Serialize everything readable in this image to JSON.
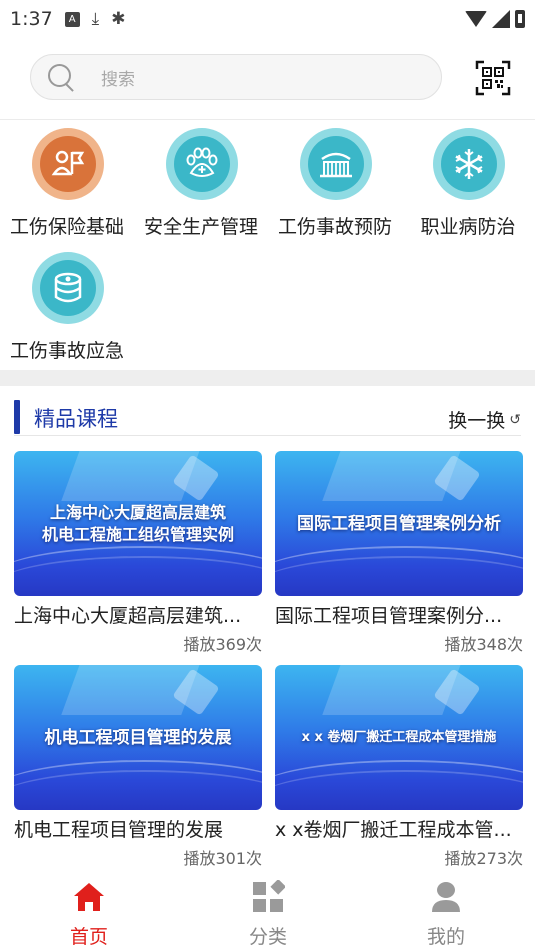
{
  "status_bar": {
    "time": "1:37"
  },
  "search": {
    "placeholder": "搜索"
  },
  "categories": [
    {
      "label": "工伤保险基础",
      "icon": "insurance-person-flag-icon",
      "color": "#d9733a",
      "ring": "#f0b48a"
    },
    {
      "label": "安全生产管理",
      "icon": "safety-paw-icon",
      "color": "#3bb7c8",
      "ring": "#8fdbe3"
    },
    {
      "label": "工伤事故预防",
      "icon": "fence-prevention-icon",
      "color": "#3bb7c8",
      "ring": "#8fdbe3"
    },
    {
      "label": "职业病防治",
      "icon": "snowflake-icon",
      "color": "#3bb7c8",
      "ring": "#8fdbe3"
    },
    {
      "label": "工伤事故应急",
      "icon": "database-gear-icon",
      "color": "#3bb7c8",
      "ring": "#8fdbe3"
    }
  ],
  "section": {
    "title": "精品课程",
    "refresh_label": "换一换"
  },
  "courses": [
    {
      "thumb_line1": "上海中心大厦超高层建筑",
      "thumb_line2": "机电工程施工组织管理实例",
      "title": "上海中心大厦超高层建筑...",
      "plays": "播放369次"
    },
    {
      "thumb_line1": "国际工程项目管理案例分析",
      "thumb_line2": "",
      "title": "国际工程项目管理案例分...",
      "plays": "播放348次"
    },
    {
      "thumb_line1": "机电工程项目管理的发展",
      "thumb_line2": "",
      "title": "机电工程项目管理的发展",
      "plays": "播放301次"
    },
    {
      "thumb_line1": "x x 卷烟厂搬迁工程成本管理措施",
      "thumb_line2": "",
      "title": "x x卷烟厂搬迁工程成本管...",
      "plays": "播放273次"
    }
  ],
  "bottom_nav": [
    {
      "label": "首页",
      "icon": "home-icon",
      "active": true
    },
    {
      "label": "分类",
      "icon": "category-grid-icon",
      "active": false
    },
    {
      "label": "我的",
      "icon": "profile-icon",
      "active": false
    }
  ],
  "colors": {
    "accent_blue": "#1e3aa8",
    "active_red": "#e0201c",
    "inactive_gray": "#888888"
  }
}
